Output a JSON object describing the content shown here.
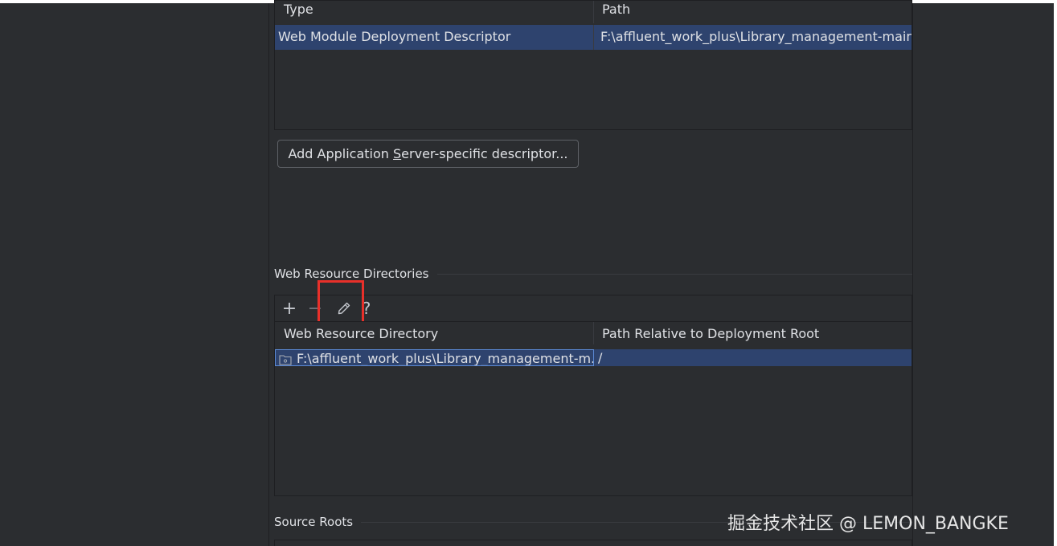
{
  "descriptors_table": {
    "columns": [
      "Type",
      "Path"
    ],
    "rows": [
      {
        "type": "Web Module Deployment Descriptor",
        "path": "F:\\affluent_work_plus\\Library_management-main\\L"
      }
    ]
  },
  "add_descriptor_button": {
    "label_prefix": "Add Application ",
    "label_mnemonic": "S",
    "label_suffix": "erver-specific descriptor..."
  },
  "web_resource_section": {
    "title": "Web Resource Directories",
    "toolbar": {
      "add": "+",
      "remove": "−",
      "edit": "edit-icon",
      "help": "?"
    },
    "columns": [
      "Web Resource Directory",
      "Path Relative to Deployment Root"
    ],
    "rows": [
      {
        "directory": "F:\\affluent_work_plus\\Library_management-m...",
        "relative_path": "/"
      }
    ]
  },
  "source_roots_section": {
    "title": "Source Roots"
  },
  "watermark": "掘金技术社区 @ LEMON_BANGKE",
  "colors": {
    "background": "#2b2d30",
    "selection": "#2e436e",
    "highlight": "#e8302a"
  }
}
